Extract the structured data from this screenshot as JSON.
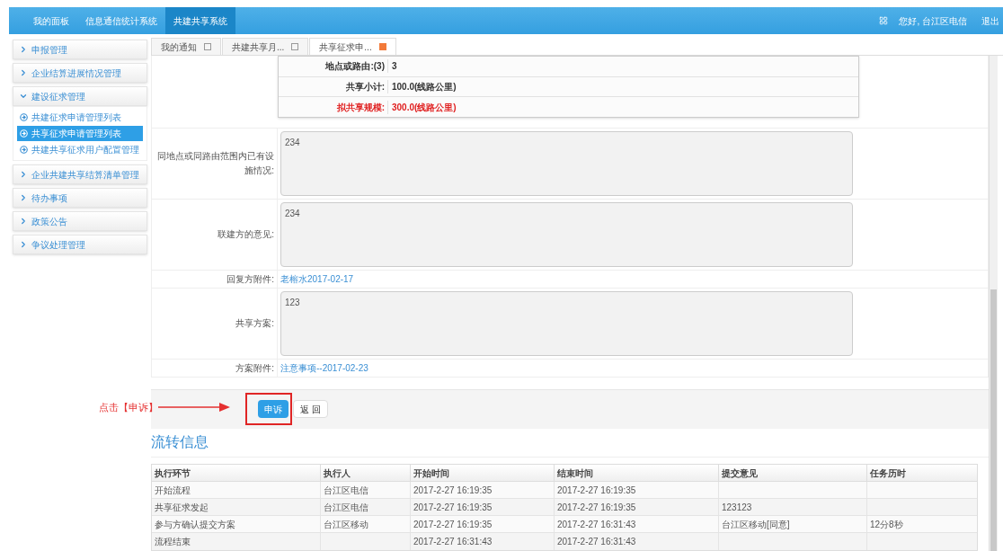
{
  "top_nav": {
    "items": [
      {
        "label": "我的面板",
        "selected": false
      },
      {
        "label": "信息通信统计系统",
        "selected": false
      },
      {
        "label": "共建共享系统",
        "selected": true
      }
    ],
    "greeting": "您好, 台江区电信",
    "logout": "退出"
  },
  "sidebar": {
    "items": [
      {
        "label": "申报管理",
        "expanded": false
      },
      {
        "label": "企业结算进展情况管理",
        "expanded": false
      },
      {
        "label": "建设征求管理",
        "expanded": true,
        "children": [
          {
            "label": "共建征求申请管理列表",
            "selected": false
          },
          {
            "label": "共享征求申请管理列表",
            "selected": true
          },
          {
            "label": "共建共享征求用户配置管理",
            "selected": false
          }
        ]
      },
      {
        "label": "企业共建共享结算清单管理",
        "expanded": false
      },
      {
        "label": "待办事项",
        "expanded": false
      },
      {
        "label": "政策公告",
        "expanded": false
      },
      {
        "label": "争议处理管理",
        "expanded": false
      }
    ]
  },
  "tabs": [
    {
      "label": "我的通知",
      "selected": false
    },
    {
      "label": "共建共享月...",
      "selected": false
    },
    {
      "label": "共享征求申...",
      "selected": true
    }
  ],
  "summary_rows": [
    {
      "label": "地点或路由:(3)",
      "value": "3",
      "highlight": false
    },
    {
      "label": "共享小计:",
      "value": "100.0(线路公里)",
      "highlight": false
    },
    {
      "label": "拟共享规模:",
      "value": "300.0(线路公里)",
      "highlight": true
    }
  ],
  "form_rows": [
    {
      "kind": "textarea",
      "label": "同地点或同路由范围内已有设施情况:",
      "value": "234"
    },
    {
      "kind": "textarea",
      "label": "联建方的意见:",
      "value": "234"
    },
    {
      "kind": "link",
      "label": "回复方附件:",
      "value": "老榕水2017-02-17"
    },
    {
      "kind": "textarea",
      "label": "共享方案:",
      "value": "123"
    },
    {
      "kind": "link",
      "label": "方案附件:",
      "value": "注意事项--2017-02-23"
    }
  ],
  "buttons": {
    "primary": "申诉",
    "secondary": "返 回"
  },
  "annotation": "点击【申诉】",
  "flow": {
    "title": "流转信息",
    "columns": [
      "执行环节",
      "执行人",
      "开始时间",
      "结束时间",
      "提交意见",
      "任务历时"
    ],
    "rows": [
      [
        "开始流程",
        "台江区电信",
        "2017-2-27 16:19:35",
        "2017-2-27 16:19:35",
        "",
        ""
      ],
      [
        "共享征求发起",
        "台江区电信",
        "2017-2-27 16:19:35",
        "2017-2-27 16:19:35",
        "123123",
        ""
      ],
      [
        "参与方确认提交方案",
        "台江区移动",
        "2017-2-27 16:19:35",
        "2017-2-27 16:31:43",
        "台江区移动[同意]",
        "12分8秒"
      ],
      [
        "流程结束",
        "",
        "2017-2-27 16:31:43",
        "2017-2-27 16:31:43",
        "",
        ""
      ]
    ]
  }
}
